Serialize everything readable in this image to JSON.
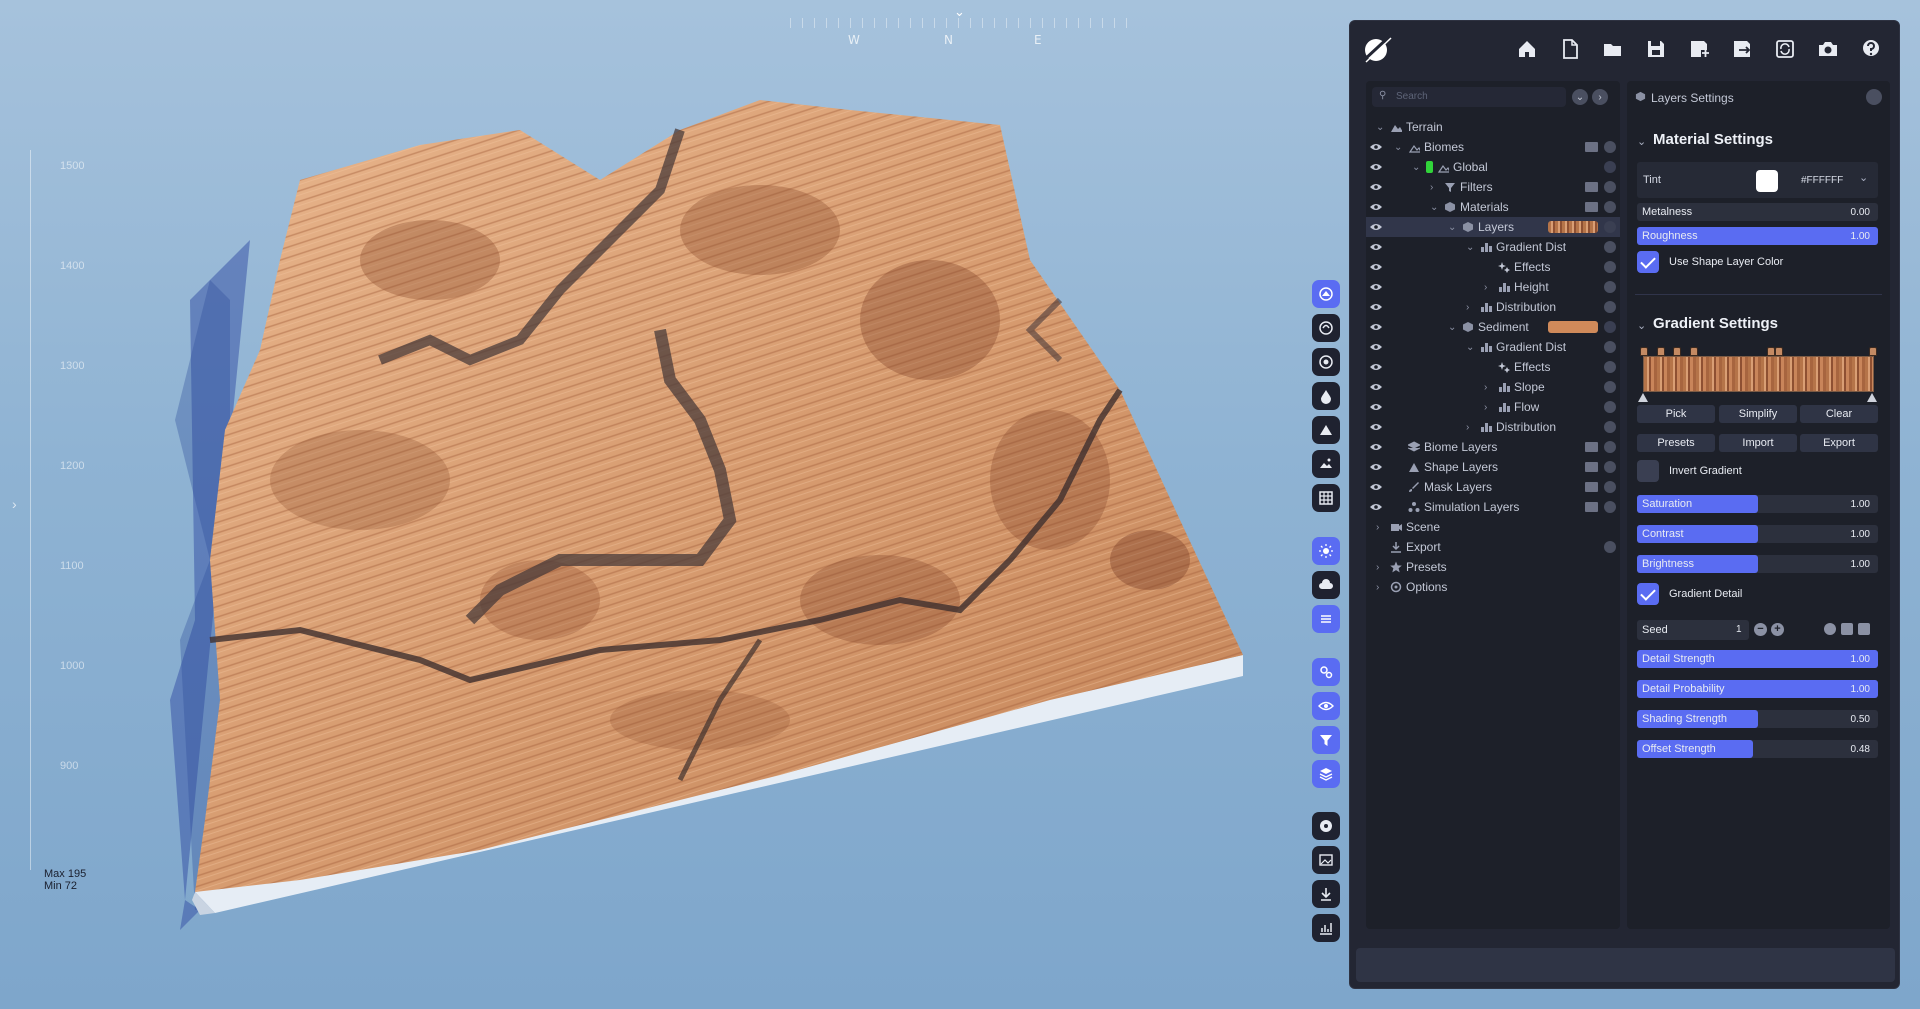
{
  "compass": {
    "labels": [
      "W",
      "N",
      "E"
    ]
  },
  "elevation_axis": {
    "ticks": [
      "1500",
      "1400",
      "1300",
      "1200",
      "1100",
      "1000",
      "900"
    ],
    "max_label": "Max 195",
    "min_label": "Min 72"
  },
  "toolbar": {
    "icons": [
      "home-icon",
      "new-file-icon",
      "open-folder-icon",
      "save-icon",
      "save-as-icon",
      "export-icon",
      "refresh-icon",
      "camera-icon",
      "help-icon"
    ]
  },
  "tree": {
    "search_placeholder": "Search",
    "rows": [
      {
        "label": "Terrain",
        "depth": 0,
        "eye": false,
        "chevron": "down",
        "icon": "terrain-icon",
        "right": "none"
      },
      {
        "label": "Biomes",
        "depth": 1,
        "eye": true,
        "chevron": "down",
        "icon": "biome-icon",
        "right": "folder-add"
      },
      {
        "label": "Global",
        "depth": 2,
        "eye": true,
        "chevron": "down",
        "icon": "biome-icon",
        "green": true,
        "right": "layers"
      },
      {
        "label": "Filters",
        "depth": 3,
        "eye": true,
        "chevron": "right",
        "icon": "filter-icon",
        "right": "folder-add"
      },
      {
        "label": "Materials",
        "depth": 3,
        "eye": true,
        "chevron": "down",
        "icon": "material-icon",
        "right": "folder-add"
      },
      {
        "label": "Layers",
        "depth": 4,
        "eye": true,
        "chevron": "down",
        "icon": "material-icon",
        "right": "swatch-striped",
        "selected": true
      },
      {
        "label": "Gradient Distribution",
        "depth": 5,
        "eye": true,
        "chevron": "down",
        "icon": "distribution-icon",
        "right": "add"
      },
      {
        "label": "Effects",
        "depth": 6,
        "eye": true,
        "chevron": "none",
        "icon": "effects-icon",
        "right": "add"
      },
      {
        "label": "Height",
        "depth": 6,
        "eye": true,
        "chevron": "right",
        "icon": "distribution-icon",
        "right": "add"
      },
      {
        "label": "Distribution",
        "depth": 5,
        "eye": true,
        "chevron": "right",
        "icon": "distribution-icon",
        "right": "add"
      },
      {
        "label": "Sediment",
        "depth": 4,
        "eye": true,
        "chevron": "down",
        "icon": "material-icon",
        "right": "swatch-solid"
      },
      {
        "label": "Gradient Distribution",
        "depth": 5,
        "eye": true,
        "chevron": "down",
        "icon": "distribution-icon",
        "right": "add"
      },
      {
        "label": "Effects",
        "depth": 6,
        "eye": true,
        "chevron": "none",
        "icon": "effects-icon",
        "right": "add"
      },
      {
        "label": "Slope",
        "depth": 6,
        "eye": true,
        "chevron": "right",
        "icon": "distribution-icon",
        "right": "add"
      },
      {
        "label": "Flow",
        "depth": 6,
        "eye": true,
        "chevron": "right",
        "icon": "distribution-icon",
        "right": "add"
      },
      {
        "label": "Distribution",
        "depth": 5,
        "eye": true,
        "chevron": "right",
        "icon": "distribution-icon",
        "right": "add"
      },
      {
        "label": "Biome Layers",
        "depth": 1,
        "eye": true,
        "chevron": "none",
        "icon": "layers-icon",
        "right": "folder-add"
      },
      {
        "label": "Shape Layers",
        "depth": 1,
        "eye": true,
        "chevron": "none",
        "icon": "shape-icon",
        "right": "folder-add"
      },
      {
        "label": "Mask Layers",
        "depth": 1,
        "eye": true,
        "chevron": "none",
        "icon": "brush-icon",
        "right": "folder-add"
      },
      {
        "label": "Simulation Layers",
        "depth": 1,
        "eye": true,
        "chevron": "none",
        "icon": "simulation-icon",
        "right": "folder-add"
      },
      {
        "label": "Scene",
        "depth": 0,
        "eye": false,
        "chevron": "right",
        "icon": "camera-icon",
        "right": "none"
      },
      {
        "label": "Export",
        "depth": 0,
        "eye": false,
        "chevron": "none",
        "icon": "export-icon",
        "right": "add"
      },
      {
        "label": "Presets",
        "depth": 0,
        "eye": false,
        "chevron": "right",
        "icon": "star-icon",
        "right": "none"
      },
      {
        "label": "Options",
        "depth": 0,
        "eye": false,
        "chevron": "right",
        "icon": "gear-icon",
        "right": "none"
      }
    ]
  },
  "settings": {
    "header": "Layers Settings",
    "material": {
      "title": "Material Settings",
      "tint_label": "Tint",
      "tint_hex": "#FFFFFF",
      "metalness_label": "Metalness",
      "metalness_value": "0.00",
      "metalness_fill": 0.0,
      "roughness_label": "Roughness",
      "roughness_value": "1.00",
      "roughness_fill": 1.0,
      "use_shape_color_label": "Use Shape Layer Color",
      "use_shape_color_checked": true
    },
    "gradient": {
      "title": "Gradient Settings",
      "buttons": [
        "Pick",
        "Simplify",
        "Clear",
        "Presets",
        "Import",
        "Export"
      ],
      "invert_label": "Invert Gradient",
      "invert_checked": false,
      "sliders": [
        {
          "label": "Saturation",
          "value": "1.00",
          "fill": 0.5
        },
        {
          "label": "Contrast",
          "value": "1.00",
          "fill": 0.5
        },
        {
          "label": "Brightness",
          "value": "1.00",
          "fill": 0.5
        }
      ],
      "detail_label": "Gradient Detail",
      "detail_checked": true,
      "seed_label": "Seed",
      "seed_value": "1",
      "detail_sliders": [
        {
          "label": "Detail Strength",
          "value": "1.00",
          "fill": 1.0
        },
        {
          "label": "Detail Probability",
          "value": "1.00",
          "fill": 1.0
        },
        {
          "label": "Shading Strength",
          "value": "0.50",
          "fill": 0.5
        },
        {
          "label": "Offset Strength",
          "value": "0.48",
          "fill": 0.48
        }
      ]
    }
  },
  "colors": {
    "accent": "#5a6cf2",
    "panel": "#232633",
    "terrain": "#d9a47a",
    "sediment_swatch": "#d08a5a"
  }
}
